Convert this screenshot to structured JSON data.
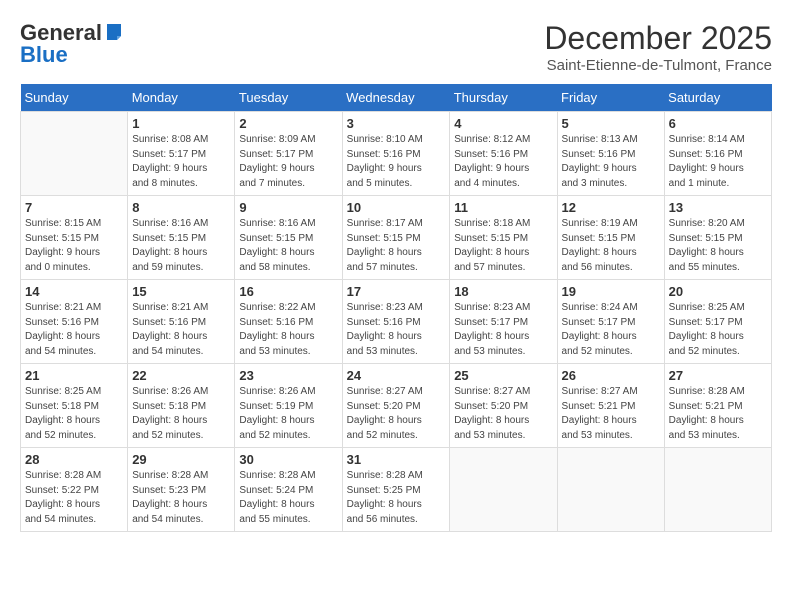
{
  "header": {
    "logo_general": "General",
    "logo_blue": "Blue",
    "month_title": "December 2025",
    "location": "Saint-Etienne-de-Tulmont, France"
  },
  "days_of_week": [
    "Sunday",
    "Monday",
    "Tuesday",
    "Wednesday",
    "Thursday",
    "Friday",
    "Saturday"
  ],
  "weeks": [
    [
      {
        "day": "",
        "info": ""
      },
      {
        "day": "1",
        "info": "Sunrise: 8:08 AM\nSunset: 5:17 PM\nDaylight: 9 hours\nand 8 minutes."
      },
      {
        "day": "2",
        "info": "Sunrise: 8:09 AM\nSunset: 5:17 PM\nDaylight: 9 hours\nand 7 minutes."
      },
      {
        "day": "3",
        "info": "Sunrise: 8:10 AM\nSunset: 5:16 PM\nDaylight: 9 hours\nand 5 minutes."
      },
      {
        "day": "4",
        "info": "Sunrise: 8:12 AM\nSunset: 5:16 PM\nDaylight: 9 hours\nand 4 minutes."
      },
      {
        "day": "5",
        "info": "Sunrise: 8:13 AM\nSunset: 5:16 PM\nDaylight: 9 hours\nand 3 minutes."
      },
      {
        "day": "6",
        "info": "Sunrise: 8:14 AM\nSunset: 5:16 PM\nDaylight: 9 hours\nand 1 minute."
      }
    ],
    [
      {
        "day": "7",
        "info": "Sunrise: 8:15 AM\nSunset: 5:15 PM\nDaylight: 9 hours\nand 0 minutes."
      },
      {
        "day": "8",
        "info": "Sunrise: 8:16 AM\nSunset: 5:15 PM\nDaylight: 8 hours\nand 59 minutes."
      },
      {
        "day": "9",
        "info": "Sunrise: 8:16 AM\nSunset: 5:15 PM\nDaylight: 8 hours\nand 58 minutes."
      },
      {
        "day": "10",
        "info": "Sunrise: 8:17 AM\nSunset: 5:15 PM\nDaylight: 8 hours\nand 57 minutes."
      },
      {
        "day": "11",
        "info": "Sunrise: 8:18 AM\nSunset: 5:15 PM\nDaylight: 8 hours\nand 57 minutes."
      },
      {
        "day": "12",
        "info": "Sunrise: 8:19 AM\nSunset: 5:15 PM\nDaylight: 8 hours\nand 56 minutes."
      },
      {
        "day": "13",
        "info": "Sunrise: 8:20 AM\nSunset: 5:15 PM\nDaylight: 8 hours\nand 55 minutes."
      }
    ],
    [
      {
        "day": "14",
        "info": "Sunrise: 8:21 AM\nSunset: 5:16 PM\nDaylight: 8 hours\nand 54 minutes."
      },
      {
        "day": "15",
        "info": "Sunrise: 8:21 AM\nSunset: 5:16 PM\nDaylight: 8 hours\nand 54 minutes."
      },
      {
        "day": "16",
        "info": "Sunrise: 8:22 AM\nSunset: 5:16 PM\nDaylight: 8 hours\nand 53 minutes."
      },
      {
        "day": "17",
        "info": "Sunrise: 8:23 AM\nSunset: 5:16 PM\nDaylight: 8 hours\nand 53 minutes."
      },
      {
        "day": "18",
        "info": "Sunrise: 8:23 AM\nSunset: 5:17 PM\nDaylight: 8 hours\nand 53 minutes."
      },
      {
        "day": "19",
        "info": "Sunrise: 8:24 AM\nSunset: 5:17 PM\nDaylight: 8 hours\nand 52 minutes."
      },
      {
        "day": "20",
        "info": "Sunrise: 8:25 AM\nSunset: 5:17 PM\nDaylight: 8 hours\nand 52 minutes."
      }
    ],
    [
      {
        "day": "21",
        "info": "Sunrise: 8:25 AM\nSunset: 5:18 PM\nDaylight: 8 hours\nand 52 minutes."
      },
      {
        "day": "22",
        "info": "Sunrise: 8:26 AM\nSunset: 5:18 PM\nDaylight: 8 hours\nand 52 minutes."
      },
      {
        "day": "23",
        "info": "Sunrise: 8:26 AM\nSunset: 5:19 PM\nDaylight: 8 hours\nand 52 minutes."
      },
      {
        "day": "24",
        "info": "Sunrise: 8:27 AM\nSunset: 5:20 PM\nDaylight: 8 hours\nand 52 minutes."
      },
      {
        "day": "25",
        "info": "Sunrise: 8:27 AM\nSunset: 5:20 PM\nDaylight: 8 hours\nand 53 minutes."
      },
      {
        "day": "26",
        "info": "Sunrise: 8:27 AM\nSunset: 5:21 PM\nDaylight: 8 hours\nand 53 minutes."
      },
      {
        "day": "27",
        "info": "Sunrise: 8:28 AM\nSunset: 5:21 PM\nDaylight: 8 hours\nand 53 minutes."
      }
    ],
    [
      {
        "day": "28",
        "info": "Sunrise: 8:28 AM\nSunset: 5:22 PM\nDaylight: 8 hours\nand 54 minutes."
      },
      {
        "day": "29",
        "info": "Sunrise: 8:28 AM\nSunset: 5:23 PM\nDaylight: 8 hours\nand 54 minutes."
      },
      {
        "day": "30",
        "info": "Sunrise: 8:28 AM\nSunset: 5:24 PM\nDaylight: 8 hours\nand 55 minutes."
      },
      {
        "day": "31",
        "info": "Sunrise: 8:28 AM\nSunset: 5:25 PM\nDaylight: 8 hours\nand 56 minutes."
      },
      {
        "day": "",
        "info": ""
      },
      {
        "day": "",
        "info": ""
      },
      {
        "day": "",
        "info": ""
      }
    ]
  ]
}
